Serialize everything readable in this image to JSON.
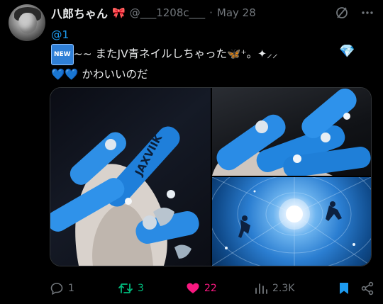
{
  "author": {
    "name": "八郎ちゃん",
    "bow": "🎀",
    "handle": "@___1208c___",
    "separator": "·",
    "date": "May 28"
  },
  "tweet": {
    "mention": "@1",
    "new_badge": "NEW",
    "line2_text": "~~ またJV青ネイルしちゃった",
    "butterfly": "🦋",
    "sparkles": "⁺。✦⸝⸝",
    "gem": "💎",
    "hearts": "💙💙",
    "line3_text": "かわいいのだ"
  },
  "media": {
    "nail_text": "JAXVIIK"
  },
  "actions": {
    "replies": "1",
    "retweets": "3",
    "likes": "22",
    "views": "2.3K"
  },
  "colors": {
    "accent_blue": "#1d9bf0",
    "retweet_green": "#00ba7c",
    "like_pink": "#f91880",
    "muted": "#71767b"
  }
}
